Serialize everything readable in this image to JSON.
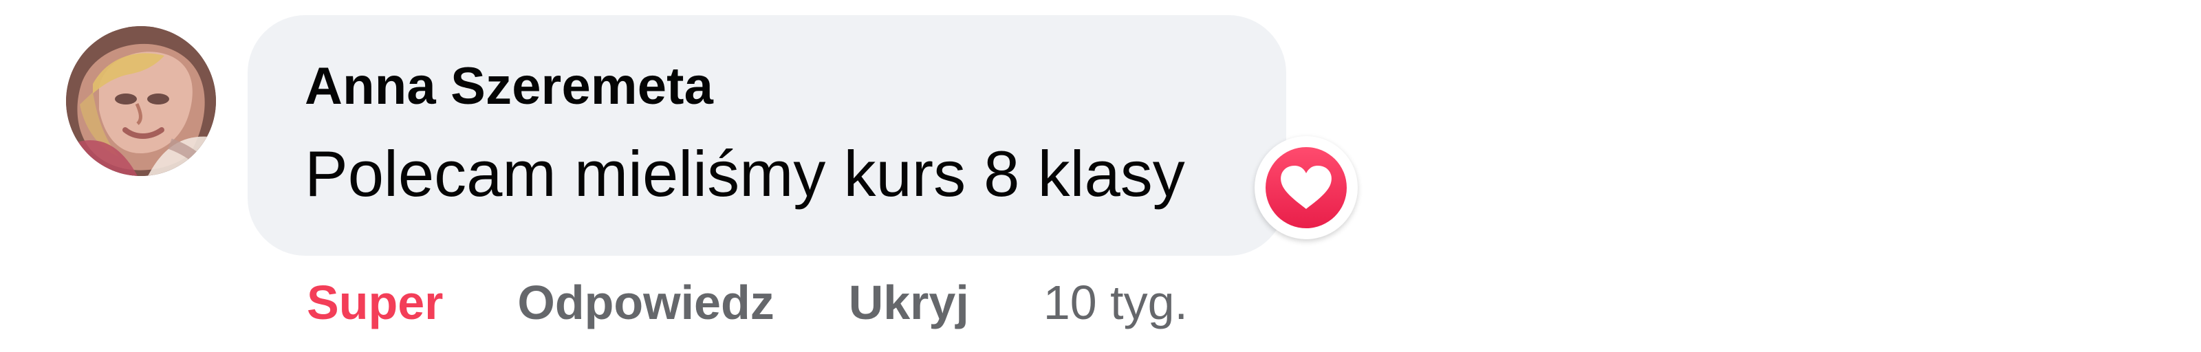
{
  "comment": {
    "author": "Anna Szeremeta",
    "text": "Polecam mieliśmy kurs 8 klasy",
    "reaction_icon": "heart-reaction-icon",
    "reaction_color": "#f33e58",
    "bubble_color": "#f0f2f5"
  },
  "actions": {
    "super": "Super",
    "reply": "Odpowiedz",
    "hide": "Ukryj",
    "time": "10 tyg."
  }
}
